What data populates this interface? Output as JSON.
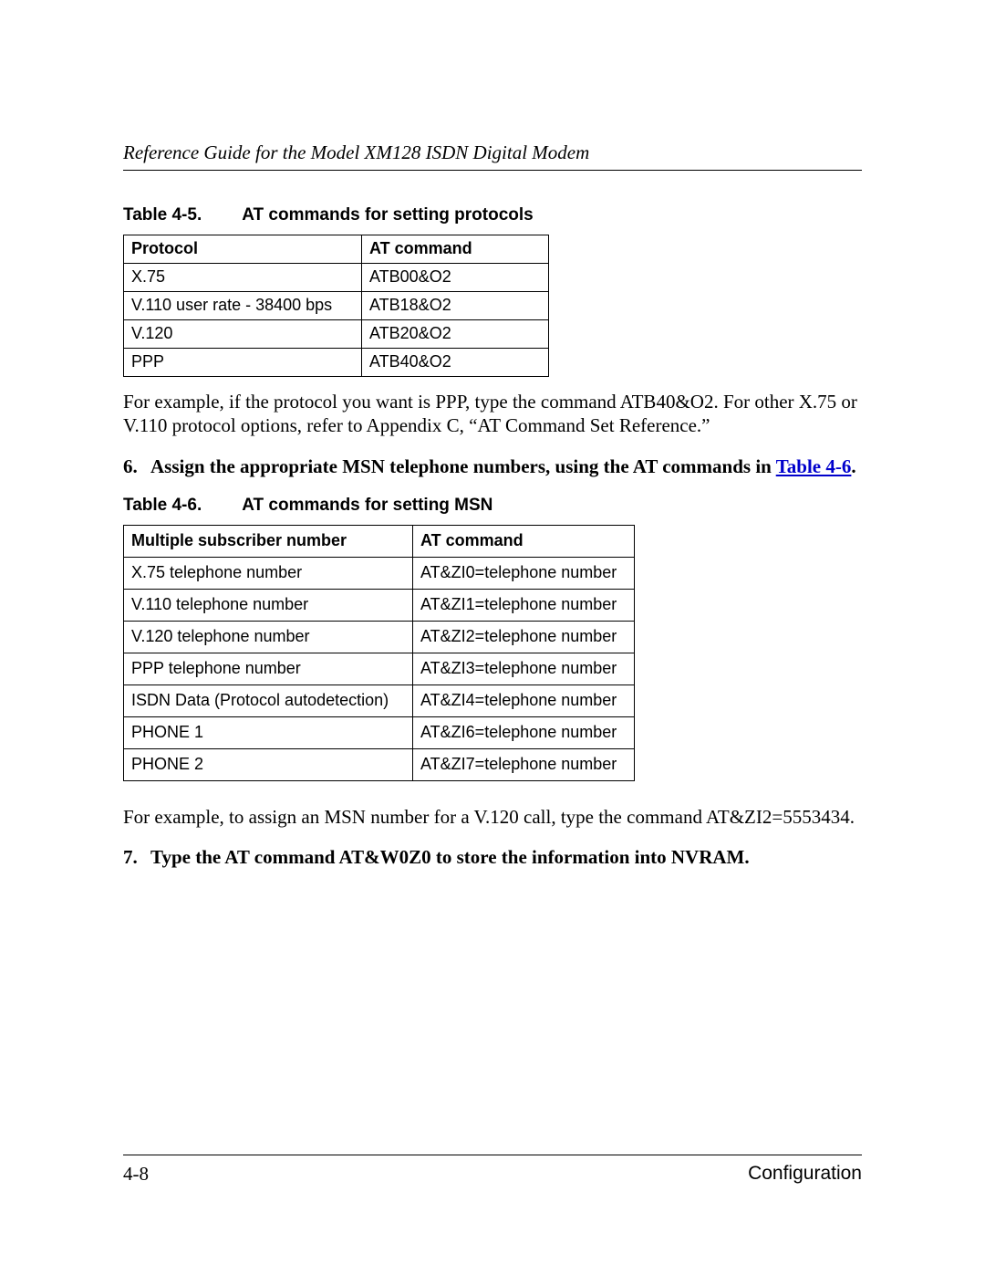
{
  "header": {
    "running_title": "Reference Guide for the Model XM128 ISDN Digital Modem"
  },
  "table45": {
    "caption_num": "Table 4-5.",
    "caption_title": "AT commands for setting protocols",
    "headers": {
      "col1": "Protocol",
      "col2": "AT command"
    },
    "rows": [
      {
        "c1": "X.75",
        "c2": "ATB00&O2"
      },
      {
        "c1": "V.110 user rate - 38400 bps",
        "c2": "ATB18&O2"
      },
      {
        "c1": "V.120",
        "c2": "ATB20&O2"
      },
      {
        "c1": "PPP",
        "c2": "ATB40&O2"
      }
    ]
  },
  "para_after_t45": "For example, if the protocol you want is PPP, type the command ATB40&O2. For other X.75 or V.110 protocol options, refer to Appendix C, “AT Command Set Reference.”",
  "step6": {
    "num": "6.",
    "text_before_link": "Assign the appropriate MSN telephone numbers, using the AT commands in ",
    "link_text": "Table 4-6",
    "text_after_link": "."
  },
  "table46": {
    "caption_num": "Table 4-6.",
    "caption_title": "AT commands for setting MSN",
    "headers": {
      "col1": "Multiple subscriber number",
      "col2": "AT command"
    },
    "rows": [
      {
        "c1": "X.75 telephone number",
        "c2": "AT&ZI0=telephone number"
      },
      {
        "c1": "V.110 telephone number",
        "c2": "AT&ZI1=telephone number"
      },
      {
        "c1": "V.120 telephone number",
        "c2": "AT&ZI2=telephone number"
      },
      {
        "c1": "PPP telephone number",
        "c2": "AT&ZI3=telephone number"
      },
      {
        "c1": "ISDN Data (Protocol autodetection)",
        "c2": "AT&ZI4=telephone number"
      },
      {
        "c1": "PHONE 1",
        "c2": "AT&ZI6=telephone number"
      },
      {
        "c1": "PHONE 2",
        "c2": "AT&ZI7=telephone number"
      }
    ]
  },
  "para_after_t46": "For example, to assign an MSN number for a V.120 call, type the command AT&ZI2=5553434.",
  "step7": {
    "num": "7.",
    "text": "Type the AT command AT&W0Z0 to store the information into NVRAM."
  },
  "footer": {
    "page": "4-8",
    "section": "Configuration"
  }
}
